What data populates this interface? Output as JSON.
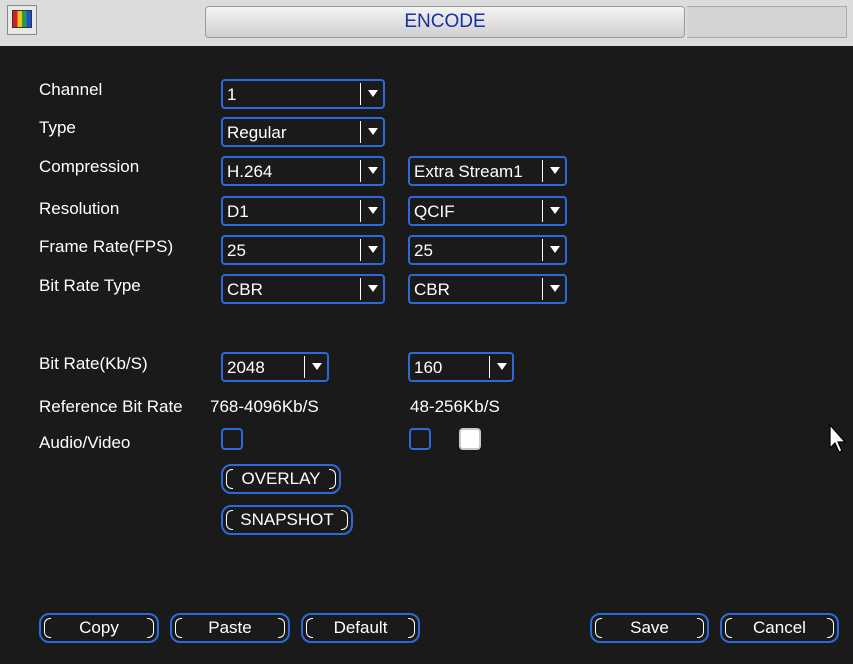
{
  "window": {
    "title": "ENCODE"
  },
  "form": {
    "channel": {
      "label": "Channel",
      "value": "1"
    },
    "type": {
      "label": "Type",
      "value": "Regular"
    },
    "compression": {
      "label": "Compression",
      "main": "H.264",
      "extra": "Extra Stream1"
    },
    "resolution": {
      "label": "Resolution",
      "main": "D1",
      "extra": "QCIF"
    },
    "frame_rate": {
      "label": "Frame Rate(FPS)",
      "main": "25",
      "extra": "25"
    },
    "bit_rate_type": {
      "label": "Bit Rate Type",
      "main": "CBR",
      "extra": "CBR"
    },
    "bit_rate": {
      "label": "Bit Rate(Kb/S)",
      "main": "2048",
      "extra": "160"
    },
    "reference_bit_rate": {
      "label": "Reference Bit Rate",
      "main": "768-4096Kb/S",
      "extra": "48-256Kb/S"
    },
    "audio_video": {
      "label": "Audio/Video",
      "main_checked": false,
      "extra_video_checked": false,
      "extra_audio_checked": true
    }
  },
  "buttons": {
    "overlay": "OVERLAY",
    "snapshot": "SNAPSHOT",
    "copy": "Copy",
    "paste": "Paste",
    "default": "Default",
    "save": "Save",
    "cancel": "Cancel"
  },
  "colors": {
    "accent": "#2c6ad8",
    "background": "#1a1a1a",
    "title_text": "#1b2fa0"
  }
}
